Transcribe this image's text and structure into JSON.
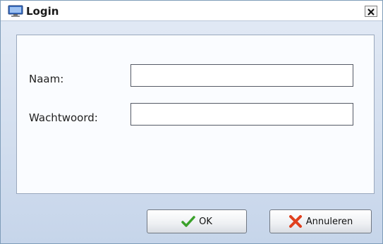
{
  "window": {
    "title": "Login",
    "title_icon": "computer-icon",
    "close_icon": "close-icon"
  },
  "form": {
    "username_label": "Naam:",
    "username_value": "",
    "password_label": "Wachtwoord:",
    "password_value": ""
  },
  "buttons": {
    "ok_label": "OK",
    "ok_icon": "checkmark-icon",
    "ok_icon_color": "#3aa12a",
    "cancel_label": "Annuleren",
    "cancel_icon": "x-icon",
    "cancel_icon_color": "#e0401e"
  }
}
